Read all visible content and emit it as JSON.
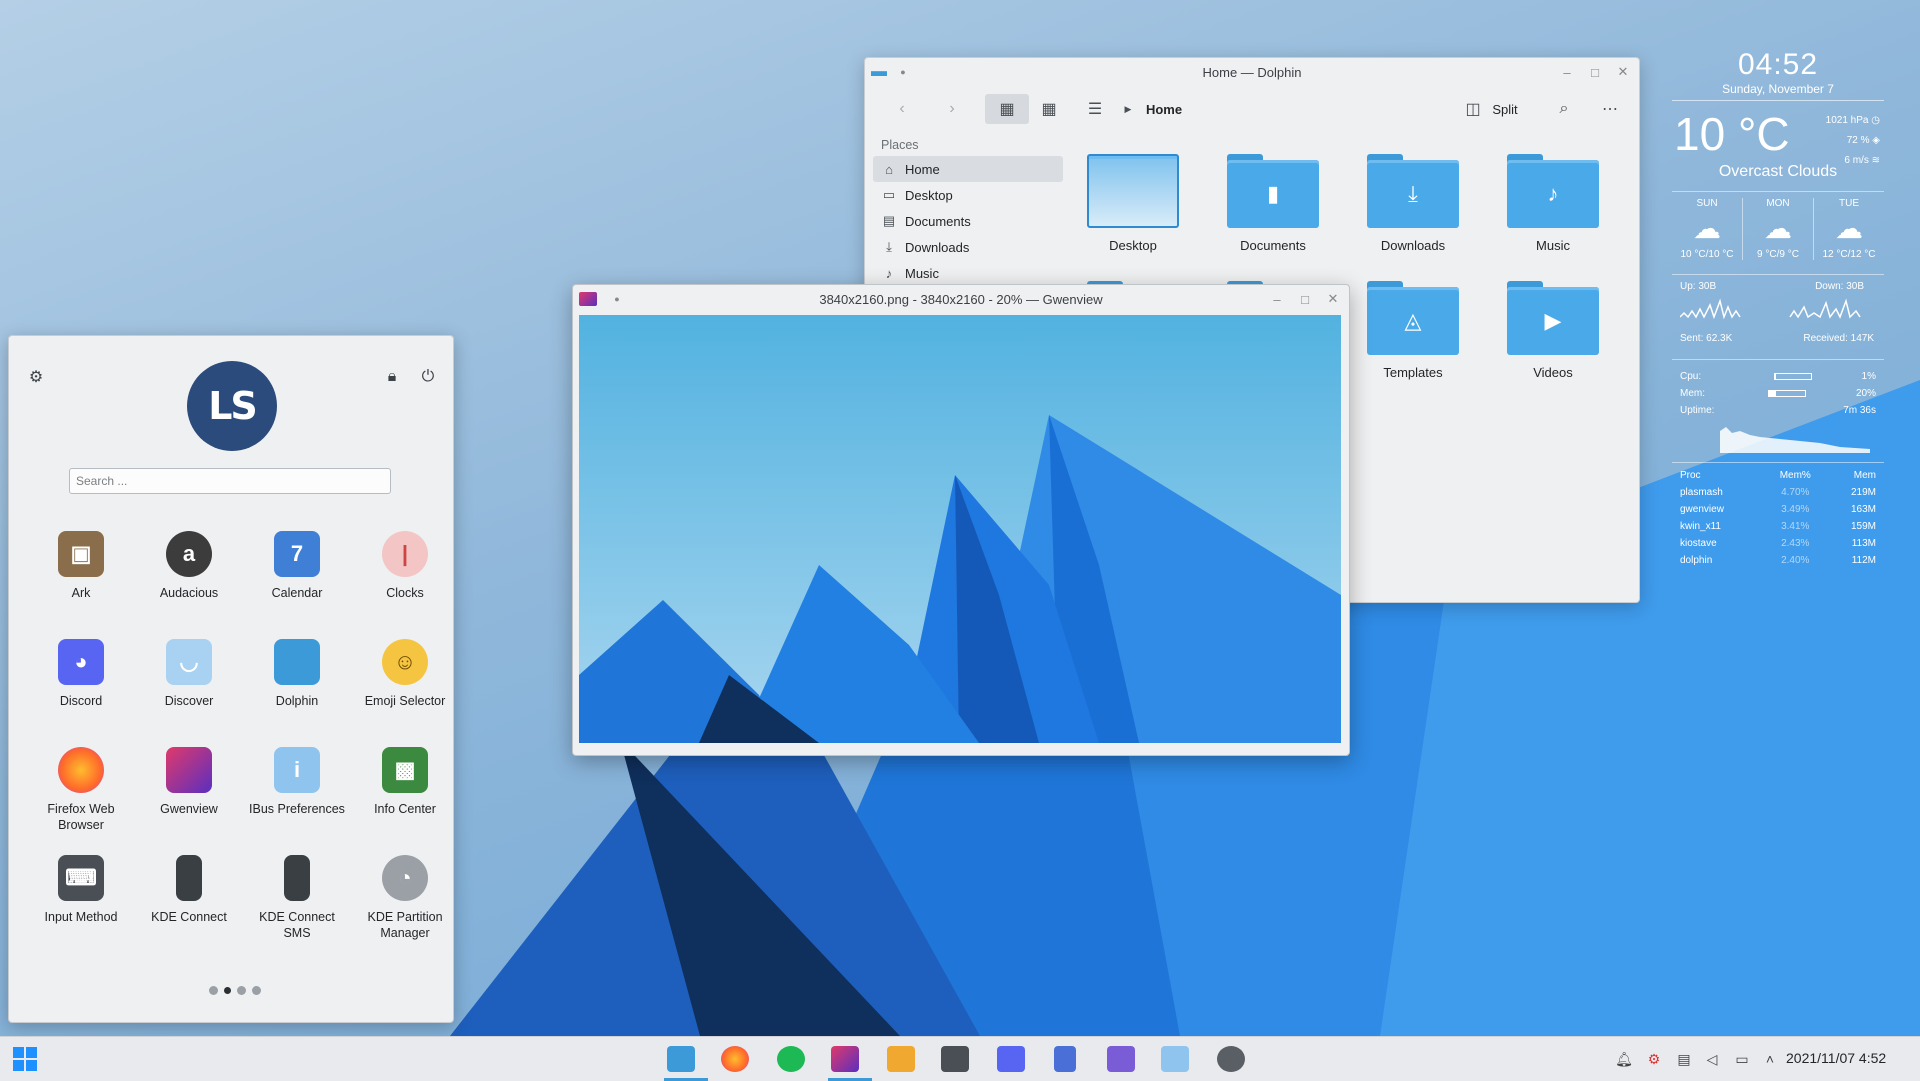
{
  "launcher": {
    "search_placeholder": "Search ...",
    "avatar_initials": "LS",
    "apps": [
      {
        "label": "Ark",
        "icon": "ark-icon",
        "color": "#8a6d4a"
      },
      {
        "label": "Audacious",
        "icon": "audacious-icon",
        "color": "#3c3c3c"
      },
      {
        "label": "Calendar",
        "icon": "calendar-icon",
        "color": "#3f7fd6"
      },
      {
        "label": "Clocks",
        "icon": "clocks-icon",
        "color": "#f3c5c5"
      },
      {
        "label": "Discord",
        "icon": "discord-icon",
        "color": "#5865f2"
      },
      {
        "label": "Discover",
        "icon": "discover-icon",
        "color": "#a9d1f2"
      },
      {
        "label": "Dolphin",
        "icon": "dolphin-icon",
        "color": "#3d9ad9"
      },
      {
        "label": "Emoji Selector",
        "icon": "emoji-icon",
        "color": "#f5c542"
      },
      {
        "label": "Firefox Web Browser",
        "icon": "firefox-icon",
        "color": "#ff6a2a"
      },
      {
        "label": "Gwenview",
        "icon": "gwenview-icon",
        "color": "#8a3fb5"
      },
      {
        "label": "IBus Preferences",
        "icon": "ibus-icon",
        "color": "#8fc4ef"
      },
      {
        "label": "Info Center",
        "icon": "info-center-icon",
        "color": "#3b8a3f"
      },
      {
        "label": "Input Method",
        "icon": "keyboard-icon",
        "color": "#4a4f55"
      },
      {
        "label": "KDE Connect",
        "icon": "kde-connect-icon",
        "color": "#3a3f44"
      },
      {
        "label": "KDE Connect SMS",
        "icon": "kde-connect-sms-icon",
        "color": "#3a3f44"
      },
      {
        "label": "KDE Partition Manager",
        "icon": "partition-manager-icon",
        "color": "#9aa0a6"
      }
    ],
    "pages": 4,
    "active_page": 1
  },
  "dolphin": {
    "title": "Home — Dolphin",
    "breadcrumb": "Home",
    "split_label": "Split",
    "places_header": "Places",
    "places": [
      {
        "label": "Home",
        "icon": "home-icon",
        "glyph": "⌂"
      },
      {
        "label": "Desktop",
        "icon": "desktop-icon",
        "glyph": "▭"
      },
      {
        "label": "Documents",
        "icon": "documents-icon",
        "glyph": "▤"
      },
      {
        "label": "Downloads",
        "icon": "downloads-icon",
        "glyph": "⤓"
      },
      {
        "label": "Music",
        "icon": "music-icon",
        "glyph": "♪"
      }
    ],
    "files": [
      "Desktop",
      "Documents",
      "Downloads",
      "Music",
      "Templates",
      "Videos"
    ]
  },
  "gwenview": {
    "title": "3840x2160.png - 3840x2160 - 20% — Gwenview"
  },
  "weather": {
    "time": "04:52",
    "date": "Sunday, November 7",
    "temp": "10 °C",
    "pressure": "1021 hPa",
    "humidity": "72 %",
    "wind": "6 m/s",
    "condition": "Overcast Clouds",
    "forecast": [
      {
        "day": "SUN",
        "range": "10 °C/10 °C"
      },
      {
        "day": "MON",
        "range": "9 °C/9 °C"
      },
      {
        "day": "TUE",
        "range": "12 °C/12 °C"
      }
    ]
  },
  "network": {
    "up": "Up: 30B",
    "down": "Down: 30B",
    "sent": "Sent: 62.3K",
    "received": "Received: 147K"
  },
  "system": {
    "cpu_label": "Cpu:",
    "cpu": "1%",
    "cpu_fraction": 0.01,
    "mem_label": "Mem:",
    "mem": "20%",
    "mem_fraction": 0.2,
    "uptime_label": "Uptime:",
    "uptime": "7m 36s",
    "headers": [
      "Proc",
      "Mem%",
      "Mem"
    ],
    "processes": [
      [
        "plasmash",
        "4.70%",
        "219M"
      ],
      [
        "gwenview",
        "3.49%",
        "163M"
      ],
      [
        "kwin_x11",
        "3.41%",
        "159M"
      ],
      [
        "kiostave",
        "2.43%",
        "113M"
      ],
      [
        "dolphin",
        "2.40%",
        "112M"
      ]
    ]
  },
  "taskbar": {
    "datetime": "2021/11/07  4:52",
    "apps": [
      {
        "name": "dolphin-task",
        "color": "#3d9ad9",
        "active": true
      },
      {
        "name": "firefox-task",
        "color": "#ff6a2a",
        "active": false
      },
      {
        "name": "spotify-task",
        "color": "#1db954",
        "active": false
      },
      {
        "name": "gwenview-task",
        "color": "#b03aa6",
        "active": true
      },
      {
        "name": "media-player-task",
        "color": "#f0a830",
        "active": false
      },
      {
        "name": "konsole-task",
        "color": "#4a4f55",
        "active": false
      },
      {
        "name": "discord-task",
        "color": "#5865f2",
        "active": false
      },
      {
        "name": "writer-task",
        "color": "#4a6fd6",
        "active": false
      },
      {
        "name": "notes-task",
        "color": "#7a5cd6",
        "active": false
      },
      {
        "name": "discover-task",
        "color": "#8fc4ef",
        "active": false
      },
      {
        "name": "settings-task",
        "color": "#5a5f65",
        "active": false
      }
    ]
  }
}
